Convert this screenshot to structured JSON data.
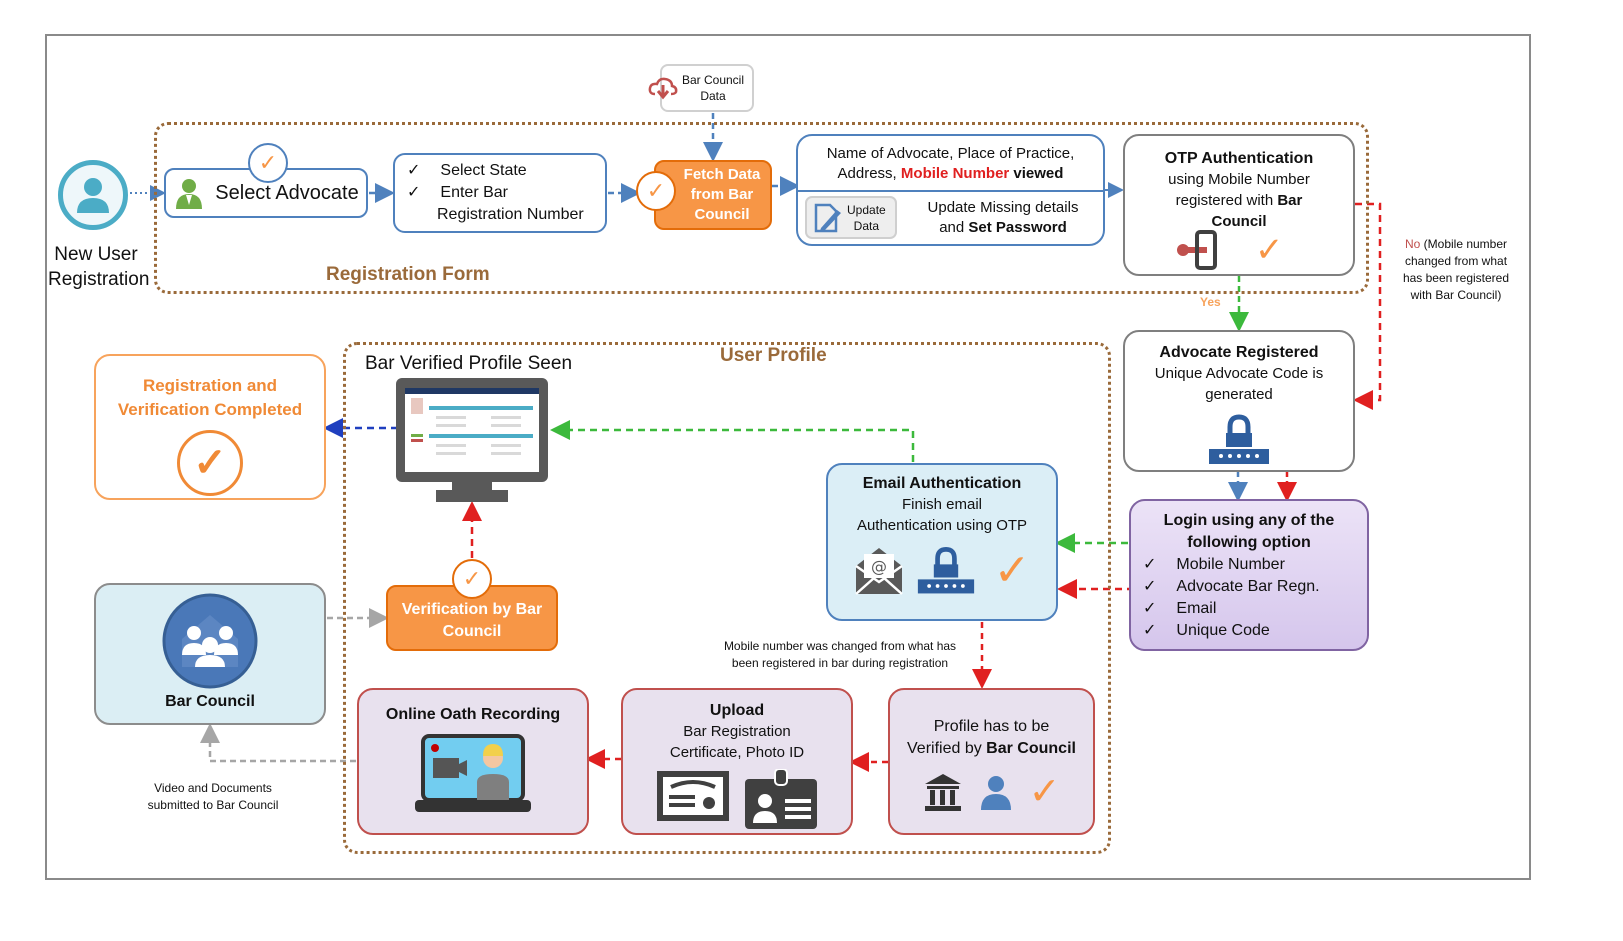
{
  "start": {
    "label_line1": "New User",
    "label_line2": "Registration"
  },
  "registration_form": {
    "title": "Registration Form",
    "select_advocate": "Select Advocate",
    "state_items": [
      "Select State",
      "Enter Bar",
      "Registration Number"
    ],
    "check_glyph": "✓",
    "fetch_data": {
      "line1": "Fetch Data",
      "line2": "from Bar",
      "line3": "Council"
    },
    "bar_council_data": {
      "line1": "Bar Council",
      "line2": "Data"
    },
    "details": {
      "line1": "Name of Advocate, Place of Practice,",
      "line2_prefix": "Address, ",
      "line2_highlight": "Mobile Number",
      "line2_suffix": " viewed",
      "update_button": {
        "line1": "Update",
        "line2": "Data"
      },
      "update_line1": "Update Missing details",
      "update_line2_prefix": "and ",
      "update_line2_bold": "Set Password"
    },
    "otp": {
      "title": "OTP Authentication",
      "line1": "using Mobile Number",
      "line2_prefix": "registered with ",
      "line2_bold": "Bar",
      "line3_bold": "Council"
    }
  },
  "decisions": {
    "yes": "Yes",
    "no_prefix": "No",
    "no_text_line1": " (Mobile number",
    "no_text_line2": "changed from what",
    "no_text_line3": "has been registered",
    "no_text_line4": "with Bar Council)"
  },
  "advocate_registered": {
    "title": "Advocate Registered",
    "line1": "Unique Advocate Code is",
    "line2": "generated"
  },
  "login": {
    "title_line1": "Login using any of the",
    "title_line2": "following option",
    "options": [
      "Mobile Number",
      "Advocate Bar Regn.",
      "Email",
      "Unique Code"
    ]
  },
  "user_profile": {
    "title": "User Profile",
    "bar_verified": "Bar Verified Profile Seen",
    "email_auth": {
      "title": "Email Authentication",
      "line1": "Finish email",
      "line2": "Authentication using OTP"
    },
    "verification": {
      "line1": "Verification by Bar",
      "line2": "Council"
    },
    "mobile_note": {
      "line1": "Mobile number was changed from what has",
      "line2": "been registered in bar during registration"
    },
    "profile_verify": {
      "line1": "Profile has to be",
      "line2_prefix": "Verified by ",
      "line2_bold": "Bar Council"
    },
    "upload": {
      "title": "Upload",
      "line1": "Bar Registration",
      "line2": "Certificate, Photo ID"
    },
    "oath": {
      "title": "Online Oath Recording"
    }
  },
  "completed": {
    "line1": "Registration and",
    "line2": "Verification Completed"
  },
  "bar_council": {
    "label": "Bar Council",
    "note_line1": "Video and Documents",
    "note_line2": "submitted to Bar Council"
  },
  "colors": {
    "blue": "#4f81bd",
    "orange": "#f79646",
    "brown": "#9a6a3a",
    "red": "#e02020",
    "green": "#3cb93c",
    "gray": "#a6a6a6",
    "navy": "#1f3fbf"
  }
}
